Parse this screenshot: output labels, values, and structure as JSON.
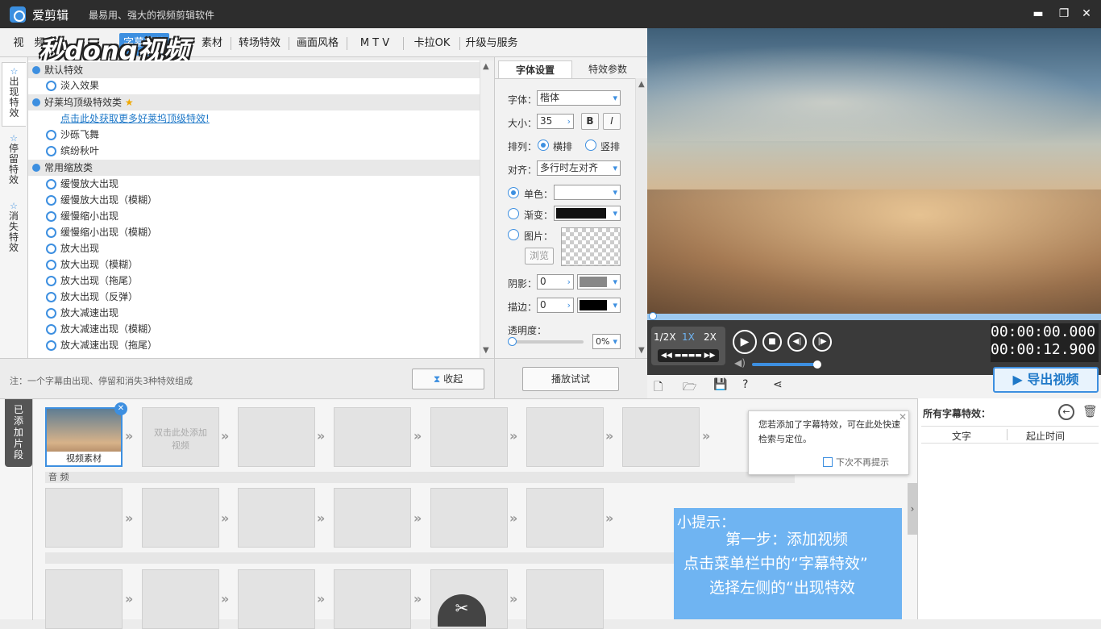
{
  "titlebar": {
    "app_name": "爱剪辑",
    "slogan": "最易用、强大的视频剪辑软件",
    "minimize": "▬",
    "restore": "❐",
    "close": "✕"
  },
  "watermark": "秒dōng视频",
  "menu": {
    "tabs": [
      "视",
      "频",
      "字幕特效",
      "素材",
      "转场特效",
      "画面风格",
      "M T V",
      "卡拉OK",
      "升级与服务"
    ]
  },
  "side_tabs": [
    {
      "icon": "☆",
      "label": "出现特效"
    },
    {
      "icon": "☆",
      "label": "停留特效"
    },
    {
      "icon": "☆",
      "label": "消失特效"
    }
  ],
  "effects": {
    "group_default": "默认特效",
    "item_fadein": "淡入效果",
    "group_hollywood": "好莱坞顶级特效类",
    "hollywood_link": "点击此处获取更多好莱坞顶级特效!",
    "item_sand": "沙砾飞舞",
    "item_leaves": "缤纷秋叶",
    "group_zoom": "常用缩放类",
    "zoom_items": [
      "缓慢放大出现",
      "缓慢放大出现（模糊）",
      "缓慢缩小出现",
      "缓慢缩小出现（模糊）",
      "放大出现",
      "放大出现（模糊）",
      "放大出现（拖尾）",
      "放大出现（反弹）",
      "放大减速出现",
      "放大减速出现（模糊）",
      "放大减速出现（拖尾）"
    ]
  },
  "note": "注：一个字幕由出现、停留和消失3种特效组成",
  "collapse_btn": "收起",
  "font_panel": {
    "tab_font": "字体设置",
    "tab_params": "特效参数",
    "font_label": "字体：",
    "font_value": "楷体",
    "size_label": "大小：",
    "size_value": "35",
    "bold": "B",
    "italic": "I",
    "layout_label": "排列：",
    "horizontal": "横排",
    "vertical": "竖排",
    "align_label": "对齐：",
    "align_value": "多行时左对齐",
    "solid_color": "单色：",
    "gradient": "渐变：",
    "image": "图片：",
    "browse": "浏览",
    "shadow_label": "阴影：",
    "shadow_value": "0",
    "stroke_label": "描边：",
    "stroke_value": "0",
    "opacity_label": "透明度：",
    "opacity_value": "0%",
    "play_test": "播放试试"
  },
  "player": {
    "speeds": [
      "1/2X",
      "1X",
      "2X"
    ],
    "time_current": "00:00:00.000",
    "time_total": "00:00:12.900",
    "export": "导出视频"
  },
  "timeline": {
    "added_label": "已添加片段",
    "clip_label": "视频素材",
    "add_clip": "双击此处添加视频",
    "audio_label": "音 频"
  },
  "tooltip": {
    "text": "您若添加了字幕特效，可在此处快速检索与定位。",
    "checkbox": "下次不再提示"
  },
  "hint": {
    "title": "小提示：",
    "line1": "第一步：添加视频",
    "line2": "点击菜单栏中的“字幕特效”",
    "line3": "选择左侧的“出现特效"
  },
  "right_panel": {
    "title": "所有字幕特效：",
    "col_text": "文字",
    "col_time": "起止时间"
  },
  "colors": {
    "accent": "#3d8fe0",
    "hint_bg": "#6fb4f2",
    "titlebar": "#2d2d2d"
  }
}
